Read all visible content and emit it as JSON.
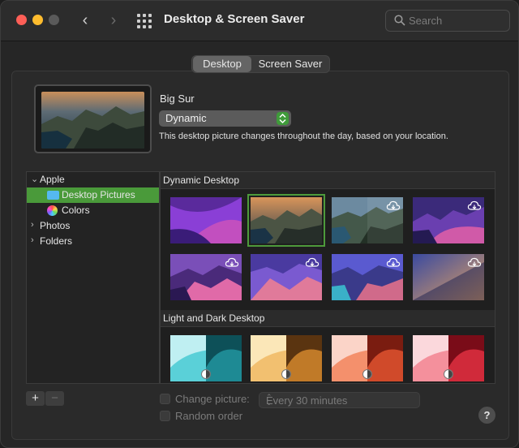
{
  "window": {
    "title": "Desktop & Screen Saver"
  },
  "search": {
    "placeholder": "Search"
  },
  "tabs": [
    {
      "label": "Desktop",
      "active": true
    },
    {
      "label": "Screen Saver",
      "active": false
    }
  ],
  "current": {
    "name": "Big Sur",
    "mode": "Dynamic",
    "description": "This desktop picture changes throughout the day, based on your location."
  },
  "sources": [
    {
      "label": "Apple",
      "expanded": true
    },
    {
      "label": "Desktop Pictures",
      "selected": true,
      "icon": "folder-icon"
    },
    {
      "label": "Colors",
      "icon": "color-wheel-icon"
    },
    {
      "label": "Photos",
      "expanded": false
    },
    {
      "label": "Folders",
      "expanded": false
    }
  ],
  "gallery": {
    "sections": [
      {
        "title": "Dynamic Desktop"
      },
      {
        "title": "Light and Dark Desktop"
      }
    ]
  },
  "footer": {
    "add": "+",
    "remove": "−",
    "change_picture": "Change picture:",
    "interval": "Every 30 minutes",
    "random_order": "Random order",
    "help": "?"
  },
  "colors": {
    "accent": "#4a9a3a",
    "close": "#fe5f57",
    "minimize": "#febc2e"
  }
}
